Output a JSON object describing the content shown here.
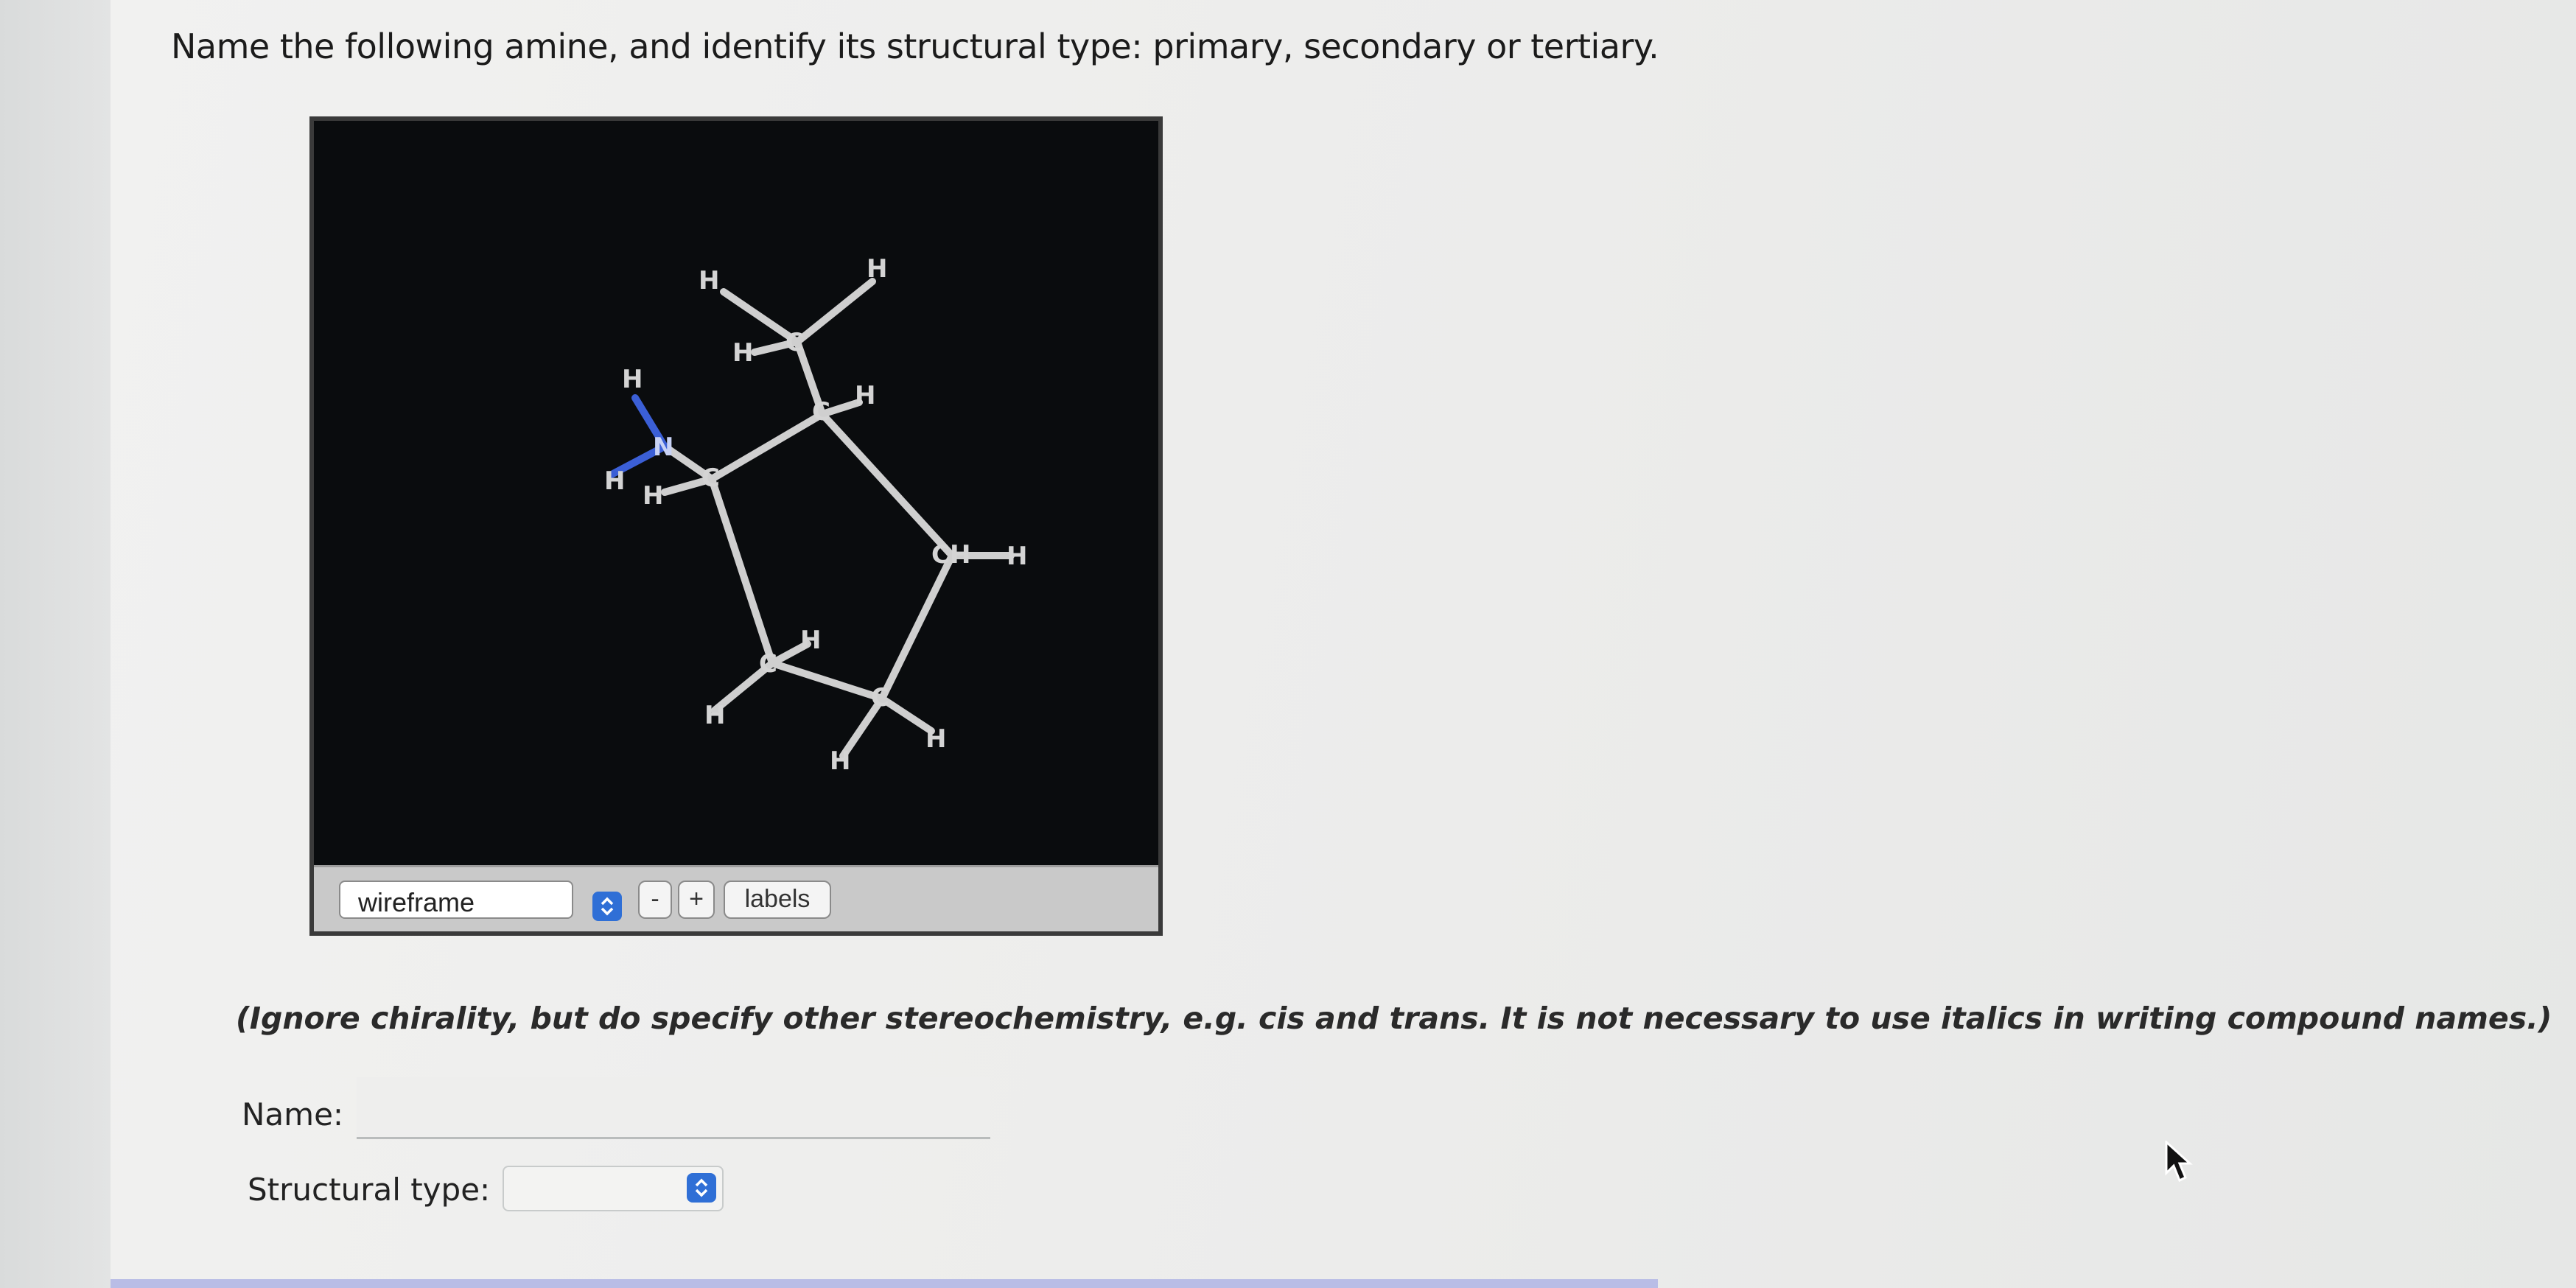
{
  "question": "Name the following amine, and identify its structural type: primary, secondary or tertiary.",
  "viewer": {
    "render_mode": "wireframe",
    "zoom_out_label": "-",
    "zoom_in_label": "+",
    "labels_button": "labels",
    "atom_labels": {
      "hydrogen": "H",
      "carbon": "C",
      "nitrogen": "N",
      "ch": "CH"
    }
  },
  "instructions": "(Ignore chirality, but do specify other stereochemistry, e.g. cis and trans. It is not necessary to use italics in writing compound names.)",
  "form": {
    "name_label": "Name:",
    "name_value": "",
    "structural_type_label": "Structural type:",
    "structural_type_value": ""
  },
  "colors": {
    "viewer_background": "#0a0c0e",
    "bond": "#cfcfcf",
    "nitrogen": "#3b5fd6",
    "spinner_blue": "#2f6fd6"
  }
}
